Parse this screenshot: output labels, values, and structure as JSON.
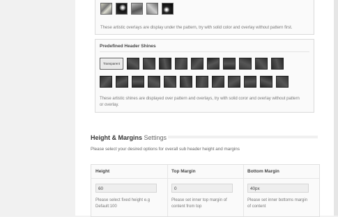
{
  "overlays": {
    "swatches": [
      "overlay-1",
      "overlay-2",
      "overlay-3",
      "overlay-4",
      "overlay-5"
    ],
    "note": "These artistic overlays are display under the pattern, try with solid color and overlay without pattern first."
  },
  "shines": {
    "title": "Predefined Header Shines",
    "selected_label": "Transparent",
    "row1_count": 11,
    "row2_count": 12,
    "note": "These artistic shines are displayed over pattern and overlays, try with solid coror and overlay without pattern or overlay."
  },
  "section": {
    "title_bold": "Height & Margins",
    "title_light": "Settings",
    "description": "Please select your desired options for overall sub header height and margins"
  },
  "fields": [
    {
      "title": "Height",
      "value": "60",
      "note": "Please select fixed height e.g Default:100"
    },
    {
      "title": "Top Margin",
      "value": "0",
      "note": "Please set inner top margin of content from top"
    },
    {
      "title": "Bottom Margin",
      "value": "40px",
      "note": "Please set inner bottoms margin of content"
    }
  ],
  "colors": {
    "panel_bg": "#ffffff",
    "page_bg": "#f2f2f2",
    "border": "#dadada"
  }
}
